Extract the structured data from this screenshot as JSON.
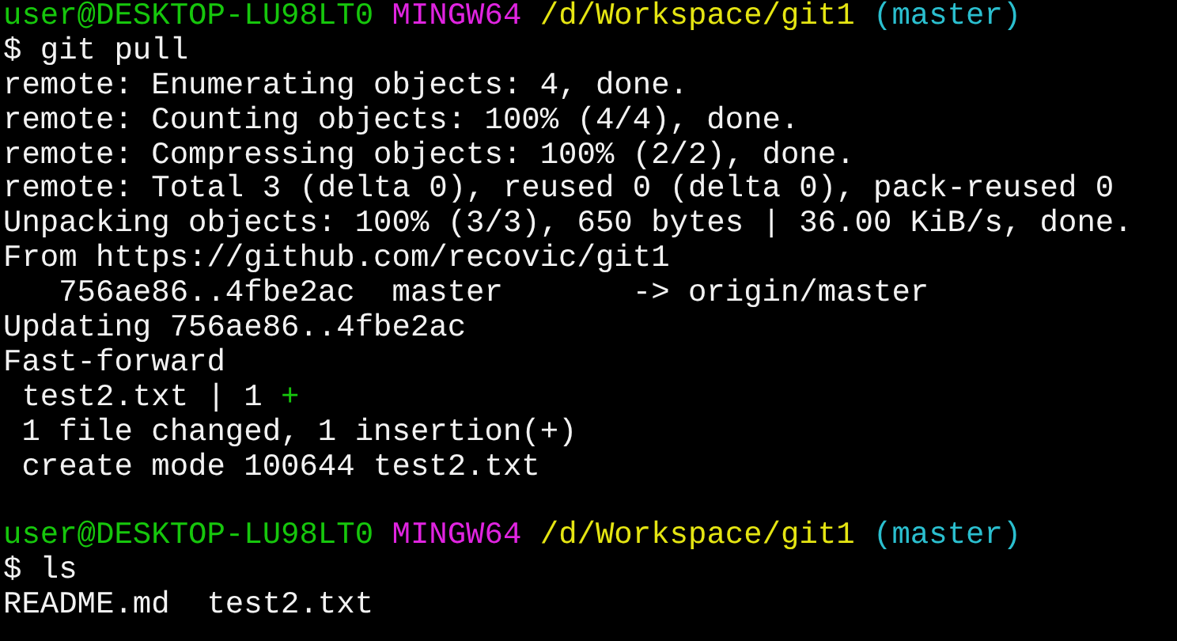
{
  "terminal": {
    "lines": [
      {
        "kind": "prompt",
        "user": "user@DESKTOP-LU98LT0",
        "shell": "MINGW64",
        "path": "/d/Workspace/git1",
        "branch": "(master)"
      },
      {
        "kind": "command",
        "prompt": "$",
        "text": "git pull"
      },
      {
        "kind": "output",
        "text": "remote: Enumerating objects: 4, done."
      },
      {
        "kind": "output",
        "text": "remote: Counting objects: 100% (4/4), done."
      },
      {
        "kind": "output",
        "text": "remote: Compressing objects: 100% (2/2), done."
      },
      {
        "kind": "output",
        "text": "remote: Total 3 (delta 0), reused 0 (delta 0), pack-reused 0"
      },
      {
        "kind": "output",
        "text": "Unpacking objects: 100% (3/3), 650 bytes | 36.00 KiB/s, done."
      },
      {
        "kind": "output",
        "text": "From https://github.com/recovic/git1"
      },
      {
        "kind": "output",
        "text": "   756ae86..4fbe2ac  master       -> origin/master"
      },
      {
        "kind": "output",
        "text": "Updating 756ae86..4fbe2ac"
      },
      {
        "kind": "output",
        "text": "Fast-forward"
      },
      {
        "kind": "diffstat",
        "text": " test2.txt | 1 ",
        "plus": "+"
      },
      {
        "kind": "output",
        "text": " 1 file changed, 1 insertion(+)"
      },
      {
        "kind": "output",
        "text": " create mode 100644 test2.txt"
      },
      {
        "kind": "blank"
      },
      {
        "kind": "prompt",
        "user": "user@DESKTOP-LU98LT0",
        "shell": "MINGW64",
        "path": "/d/Workspace/git1",
        "branch": "(master)"
      },
      {
        "kind": "command",
        "prompt": "$",
        "text": "ls"
      },
      {
        "kind": "output",
        "text": "README.md  test2.txt"
      }
    ]
  }
}
